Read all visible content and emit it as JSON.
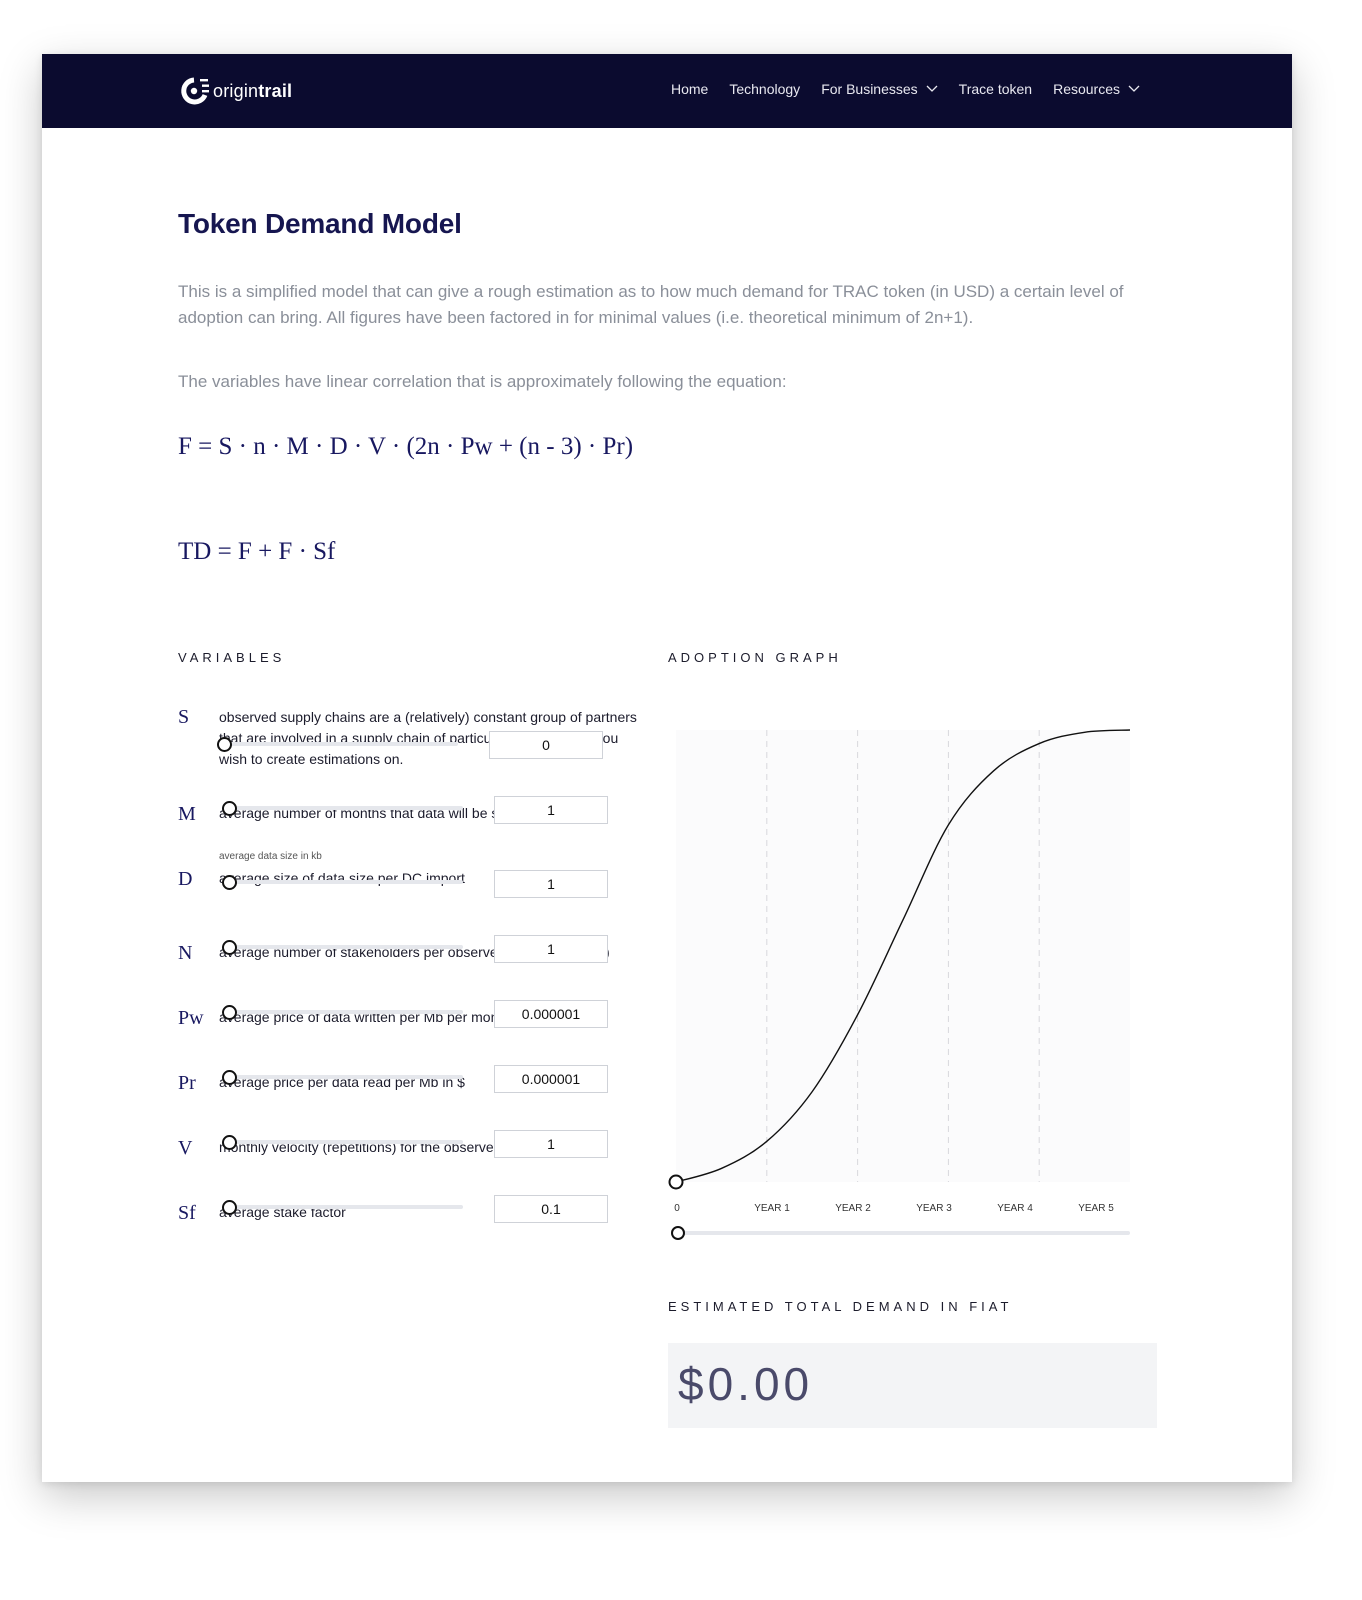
{
  "nav": {
    "logo_text_light": "origin",
    "logo_text_bold": "trail",
    "items": [
      {
        "label": "Home",
        "dropdown": false
      },
      {
        "label": "Technology",
        "dropdown": false
      },
      {
        "label": "For Businesses",
        "dropdown": true
      },
      {
        "label": "Trace token",
        "dropdown": false
      },
      {
        "label": "Resources",
        "dropdown": true
      }
    ]
  },
  "page": {
    "title": "Token Demand Model",
    "intro": "This is a simplified model that can give a rough estimation as to how much demand for TRAC token (in USD) a certain level of adoption can bring. All figures have been factored in for minimal values (i.e. theoretical minimum of 2n+1).",
    "intro2": "The variables have linear correlation that is approximately following the equation:",
    "equation1": "F = S · n · M · D · V · (2n · Pw + (n - 3) · Pr)",
    "equation2": "TD = F + F · Sf"
  },
  "variables": {
    "heading": "VARIABLES",
    "items": [
      {
        "symbol": "S",
        "desc": "observed supply chains are a (relatively) constant group of partners that are involved in a supply chain of particular products that you wish to create estimations on.",
        "hint": "",
        "value": "0",
        "slider": 0
      },
      {
        "symbol": "M",
        "desc": "average number of months that data will be stored on the ODN",
        "hint": "",
        "value": "1",
        "slider": 0
      },
      {
        "symbol": "D",
        "desc": "average size of data size per DC import",
        "hint": "average data size in kb",
        "value": "1",
        "slider": 0
      },
      {
        "symbol": "N",
        "desc": "average number of stakeholders per observed supply chain (S)",
        "hint": "",
        "value": "1",
        "slider": 0
      },
      {
        "symbol": "Pw",
        "desc": "average price of data written per Mb per month in $",
        "hint": "",
        "value": "0.000001",
        "slider": 0
      },
      {
        "symbol": "Pr",
        "desc": "average price per data read per Mb in $",
        "hint": "",
        "value": "0.000001",
        "slider": 0
      },
      {
        "symbol": "V",
        "desc": "monthly velocity (repetitions) for the observed batch",
        "hint": "",
        "value": "1",
        "slider": 0
      },
      {
        "symbol": "Sf",
        "desc": "average stake factor",
        "hint": "",
        "value": "0.1",
        "slider": 0
      }
    ]
  },
  "graph": {
    "heading": "ADOPTION GRAPH",
    "slider": 0
  },
  "chart_data": {
    "type": "line",
    "x_labels": [
      "0",
      "YEAR 1",
      "YEAR 2",
      "YEAR 3",
      "YEAR 4",
      "YEAR 5"
    ],
    "x": [
      0,
      0.5,
      1,
      1.5,
      2,
      2.5,
      3,
      3.5,
      4,
      4.5,
      5
    ],
    "y": [
      0,
      0.03,
      0.09,
      0.2,
      0.37,
      0.58,
      0.79,
      0.91,
      0.97,
      0.995,
      1
    ],
    "xlim": [
      0,
      5
    ],
    "ylim": [
      0,
      1
    ],
    "grid": "vertical dashed"
  },
  "total": {
    "heading": "ESTIMATED TOTAL DEMAND IN FIAT",
    "value": "$0.00"
  }
}
